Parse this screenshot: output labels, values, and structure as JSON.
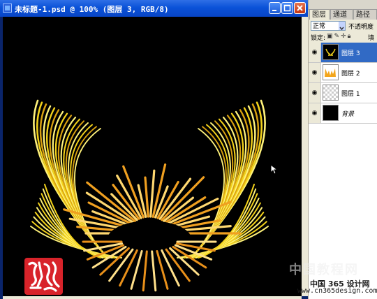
{
  "document": {
    "title": "未标题-1.psd @ 100% (图层 3, RGB/8)",
    "controls": {
      "minimize": "minimize-icon",
      "maximize": "maximize-icon",
      "close": "close-icon"
    }
  },
  "seal": {
    "text": "海汐溪"
  },
  "panel": {
    "tabs": [
      {
        "label": "图层"
      },
      {
        "label": "通道"
      },
      {
        "label": "路径"
      }
    ],
    "blend_mode": "正常",
    "opacity_label": "不透明度",
    "lock_label": "锁定:",
    "fill_label": "填充",
    "layers": [
      {
        "name": "图层 3",
        "selected": true
      },
      {
        "name": "图层 2",
        "selected": false
      },
      {
        "name": "图层 1",
        "selected": false
      },
      {
        "name": "背景",
        "selected": false
      }
    ]
  },
  "watermark": {
    "big": "中国教程网",
    "mid": "中国 365 设计网",
    "url": "www.cn365design.com"
  },
  "colors": {
    "titlebar": "#0a52d8",
    "selection": "#316ac5",
    "flame_yellow": "#f3d21a",
    "flame_orange": "#e8901a",
    "seal_red": "#d8232a"
  }
}
